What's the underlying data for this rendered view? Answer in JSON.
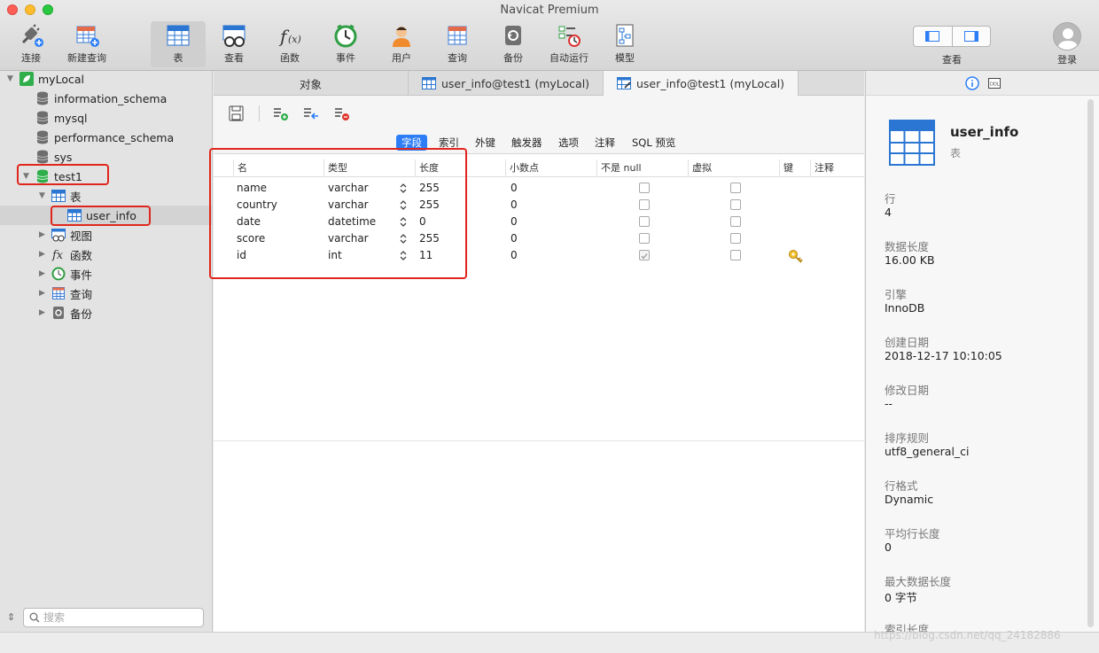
{
  "window": {
    "title": "Navicat Premium"
  },
  "toolbar": {
    "items": [
      {
        "label": "连接",
        "icon": "plug-icon"
      },
      {
        "label": "新建查询",
        "icon": "new-query-icon"
      },
      {
        "label": "表",
        "icon": "table-icon"
      },
      {
        "label": "查看",
        "icon": "view-icon"
      },
      {
        "label": "函数",
        "icon": "function-icon"
      },
      {
        "label": "事件",
        "icon": "event-clock-icon"
      },
      {
        "label": "用户",
        "icon": "user-icon"
      },
      {
        "label": "查询",
        "icon": "query-icon"
      },
      {
        "label": "备份",
        "icon": "backup-icon"
      },
      {
        "label": "自动运行",
        "icon": "automation-icon"
      },
      {
        "label": "模型",
        "icon": "model-icon"
      }
    ],
    "view_label": "查看",
    "login_label": "登录"
  },
  "sidebar": {
    "connection": "myLocal",
    "databases": [
      "information_schema",
      "mysql",
      "performance_schema",
      "sys"
    ],
    "selected_db": "test1",
    "groups": {
      "tables": "表",
      "views": "视图",
      "functions": "函数",
      "events": "事件",
      "queries": "查询",
      "backups": "备份"
    },
    "selected_table": "user_info",
    "search_placeholder": "搜索"
  },
  "tabs": [
    {
      "label": "对象"
    },
    {
      "label": "user_info@test1 (myLocal)"
    },
    {
      "label": "user_info@test1 (myLocal)"
    }
  ],
  "subtabs": [
    "字段",
    "索引",
    "外键",
    "触发器",
    "选项",
    "注释",
    "SQL 预览"
  ],
  "grid": {
    "headers": [
      "名",
      "类型",
      "长度",
      "小数点",
      "不是 null",
      "虚拟",
      "键",
      "注释"
    ],
    "rows": [
      {
        "name": "name",
        "type": "varchar",
        "length": "255",
        "decimals": "0",
        "not_null": false,
        "virtual": false,
        "key": false
      },
      {
        "name": "country",
        "type": "varchar",
        "length": "255",
        "decimals": "0",
        "not_null": false,
        "virtual": false,
        "key": false
      },
      {
        "name": "date",
        "type": "datetime",
        "length": "0",
        "decimals": "0",
        "not_null": false,
        "virtual": false,
        "key": false
      },
      {
        "name": "score",
        "type": "varchar",
        "length": "255",
        "decimals": "0",
        "not_null": false,
        "virtual": false,
        "key": false
      },
      {
        "name": "id",
        "type": "int",
        "length": "11",
        "decimals": "0",
        "not_null": true,
        "virtual": false,
        "key": true
      }
    ]
  },
  "info_panel": {
    "title": "user_info",
    "subtitle": "表",
    "props": [
      {
        "label": "行",
        "value": "4"
      },
      {
        "label": "数据长度",
        "value": "16.00 KB"
      },
      {
        "label": "引擎",
        "value": "InnoDB"
      },
      {
        "label": "创建日期",
        "value": "2018-12-17 10:10:05"
      },
      {
        "label": "修改日期",
        "value": "--"
      },
      {
        "label": "排序规则",
        "value": "utf8_general_ci"
      },
      {
        "label": "行格式",
        "value": "Dynamic"
      },
      {
        "label": "平均行长度",
        "value": "0"
      },
      {
        "label": "最大数据长度",
        "value": "0 字节"
      },
      {
        "label": "索引长度",
        "value": ""
      }
    ]
  },
  "watermark": "https://blog.csdn.net/qq_24182886",
  "colors": {
    "highlight": "#e0261c",
    "accent": "#2d7ef6"
  }
}
